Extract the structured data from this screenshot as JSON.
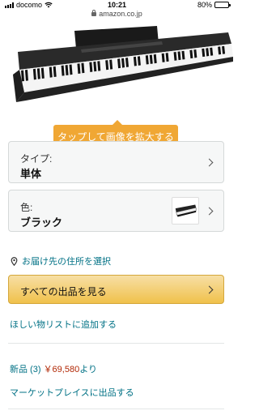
{
  "status_bar": {
    "carrier": "docomo",
    "time": "10:21",
    "battery": "80%",
    "battery_level": 0.8
  },
  "url_bar": {
    "domain": "amazon.co.jp"
  },
  "product": {
    "image_icon": "digital-piano-image",
    "brand_mark": "ALESIS"
  },
  "zoom_tooltip": {
    "text": "タップして画像を拡大する"
  },
  "variants": {
    "type": {
      "label": "タイプ:",
      "value": "単体"
    },
    "color": {
      "label": "色:",
      "value": "ブラック",
      "swatch_icon": "piano-thumbnail"
    }
  },
  "delivery": {
    "address_link": "お届け先の住所を選択",
    "icon": "location-pin-icon"
  },
  "actions": {
    "see_all_offers": "すべての出品を見る",
    "wishlist": "ほしい物リストに追加する"
  },
  "offers": {
    "new_prefix": "新品 (3)",
    "price": "￥69,580",
    "suffix": "より",
    "marketplace_link": "マーケットプレイスに出品する"
  },
  "colors": {
    "link": "#007185",
    "price": "#b12704",
    "tooltip": "#f0a734",
    "button": "#f0c14b"
  }
}
